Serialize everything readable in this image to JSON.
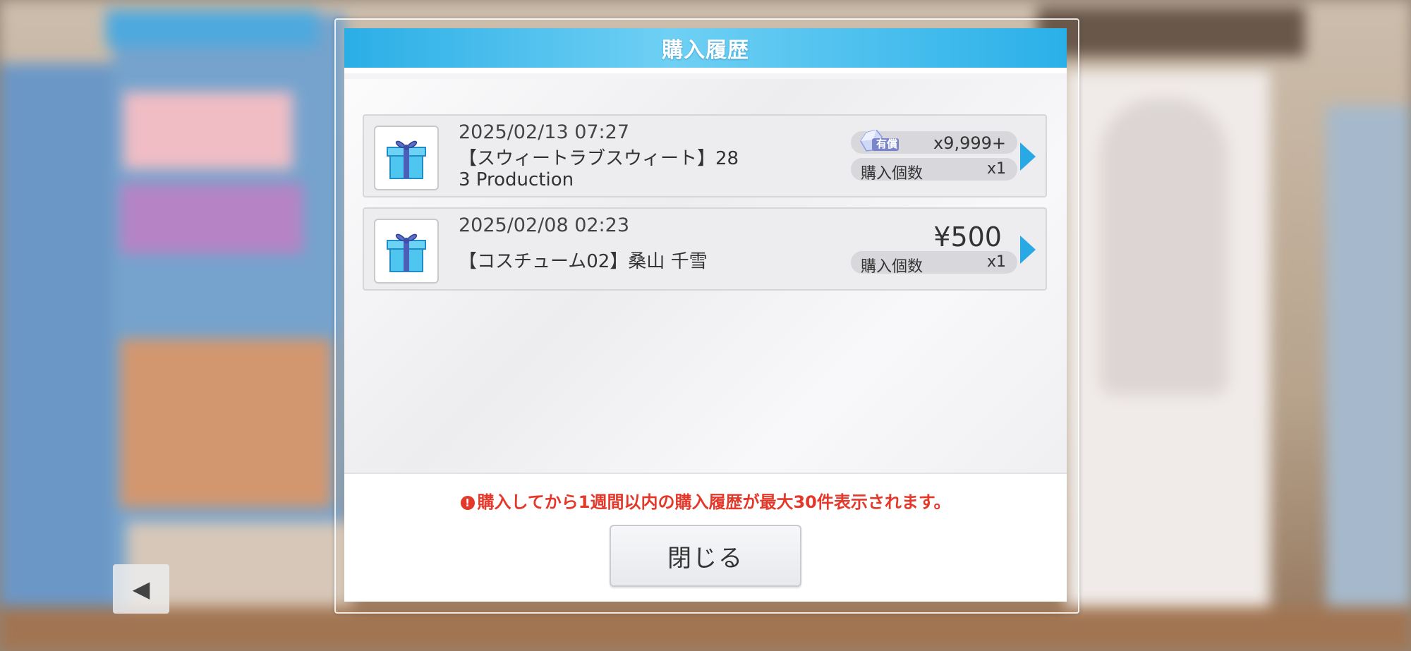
{
  "dialog": {
    "title": "購入履歴",
    "items": [
      {
        "date": "2025/02/13 07:27",
        "name": "【スウィートラブスウィート】28\n3 Production",
        "currency_badge": "有償",
        "price": "x9,999+",
        "quantity_label": "購入個数",
        "quantity": "x1",
        "icon": "gift-box-icon"
      },
      {
        "date": "2025/02/08 02:23",
        "name": "【コスチューム02】桑山 千雪",
        "price": "¥500",
        "quantity_label": "購入個数",
        "quantity": "x1",
        "icon": "gift-box-icon"
      }
    ],
    "notice_icon": "!",
    "notice": "購入してから1週間以内の購入履歴が最大30件表示されます。",
    "close_label": "閉じる"
  },
  "colors": {
    "header": "#2aaee6",
    "notice": "#e4382b",
    "arrow": "#29a9e4"
  }
}
